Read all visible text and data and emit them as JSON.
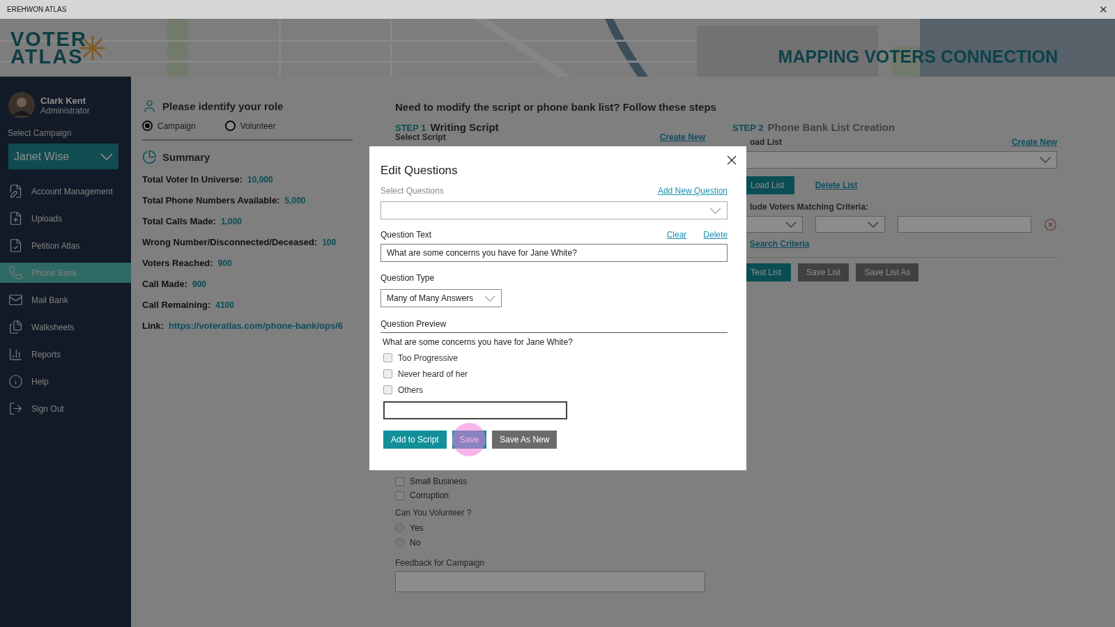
{
  "title_bar": {
    "title": "EREHWON ATLAS",
    "close": "✕"
  },
  "header": {
    "logo": [
      "VOTER",
      "ATLAS"
    ],
    "title": "MAPPING VOTERS CONNECTION"
  },
  "user": {
    "name": "Clark Kent",
    "role": "Administrator"
  },
  "campaign": {
    "label": "Select Campaign",
    "value": "Janet Wise"
  },
  "nav": [
    {
      "label": "Account Management",
      "selected": false
    },
    {
      "label": "Uploads",
      "selected": false
    },
    {
      "label": "Petition Atlas",
      "selected": false
    },
    {
      "label": "Phone Bank",
      "selected": true
    },
    {
      "label": "Mail Bank",
      "selected": false
    },
    {
      "label": "Walksheets",
      "selected": false
    },
    {
      "label": "Reports",
      "selected": false
    },
    {
      "label": "Help",
      "selected": false
    },
    {
      "label": "Sign Out",
      "selected": false
    }
  ],
  "role": {
    "title": "Please identify your role",
    "options": [
      {
        "label": "Campaign",
        "selected": true
      },
      {
        "label": "Volunteer",
        "selected": false
      }
    ]
  },
  "summary": {
    "title": "Summary",
    "stats": [
      {
        "label": "Total Voter In Universe:",
        "value": "10,000"
      },
      {
        "label": "Total Phone Numbers Available:",
        "value": "5,000"
      },
      {
        "label": "Total Calls Made:",
        "value": "1,000"
      },
      {
        "label": "Wrong Number/Disconnected/Deceased:",
        "value": "100"
      },
      {
        "label": "Voters Reached:",
        "value": "900"
      },
      {
        "label": "Call Made:",
        "value": "900"
      },
      {
        "label": "Call Remaining:",
        "value": "4100"
      }
    ],
    "link": {
      "label": "Link:",
      "url": "https://voteratlas.com/phone-bank/ops/6"
    }
  },
  "steps_heading": "Need to modify the script or phone bank list? Follow these steps",
  "step1": {
    "step": "STEP 1",
    "title": "Writing Script",
    "field_label": "Select Script",
    "link": "Create New",
    "options": [
      {
        "label": "Small Business",
        "checked": false
      },
      {
        "label": "Corruption",
        "checked": false
      }
    ],
    "question": "Can You Volunteer ?",
    "radios": [
      {
        "label": "Yes",
        "selected": false
      },
      {
        "label": "No",
        "selected": false
      }
    ],
    "feedback_label": "Feedback for Campaign"
  },
  "step2": {
    "step": "STEP 2",
    "title": "Phone Bank List Creation",
    "field_label": "oad List",
    "link": "Create New",
    "load_button": "Load List",
    "delete_link": "Delete List",
    "criteria_label": "lude Voters Matching Criteria:",
    "criteria_link": "Search Criteria",
    "buttons": [
      {
        "label": "Test List",
        "kind": "primary"
      },
      {
        "label": "Save List",
        "kind": "secondary"
      },
      {
        "label": "Save List As",
        "kind": "secondary"
      }
    ]
  },
  "modal": {
    "title": "Edit Questions",
    "select_label": "Select Questions",
    "add_link": "Add New Question",
    "text_label": "Question Text",
    "clear_link": "Clear",
    "delete_link": "Delete",
    "text_value": "What are some concerns you have for Jane White?",
    "type_label": "Question Type",
    "type_value": "Many of Many Answers",
    "preview_label": "Question Preview",
    "preview_question": "What are some concerns you have for Jane White?",
    "options": [
      {
        "label": "Too Progressive",
        "checked": false
      },
      {
        "label": "Never heard of her",
        "checked": false
      },
      {
        "label": "Others",
        "checked": false
      }
    ],
    "buttons": [
      {
        "label": "Add to Script",
        "kind": "primary",
        "pressed": false
      },
      {
        "label": "Save",
        "kind": "primary",
        "pressed": true
      },
      {
        "label": "Save As New",
        "kind": "secondary",
        "pressed": false
      }
    ]
  }
}
